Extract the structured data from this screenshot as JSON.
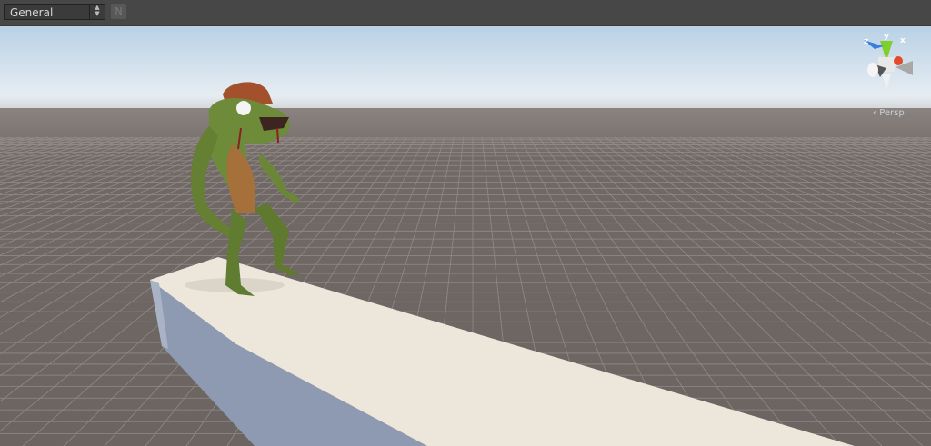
{
  "toolbar": {
    "draw_mode": "General",
    "n_button": "N"
  },
  "gizmo": {
    "projection_label": "Persp",
    "axes": {
      "x": "x",
      "y": "y",
      "z": "z"
    }
  },
  "colors": {
    "toolbar": "#474747",
    "sky_top": "#bcd3e6",
    "horizon": "#e6edf2",
    "ground": "#6f6764",
    "beam_top": "#ede7db",
    "beam_side": "#8e9ab1"
  }
}
